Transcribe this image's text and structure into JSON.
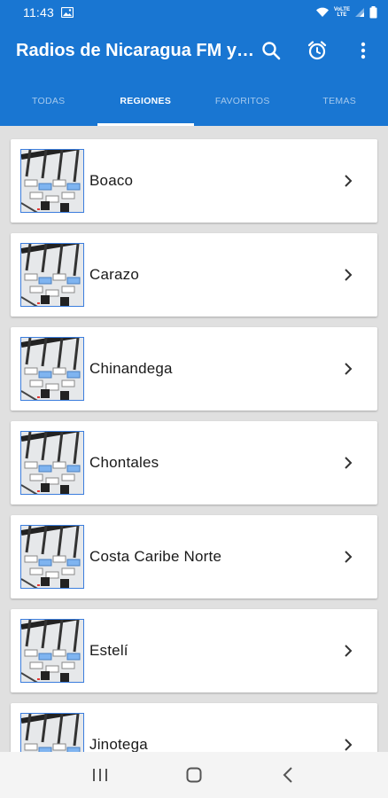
{
  "status": {
    "time": "11:43",
    "icons": [
      "gallery-icon",
      "wifi-icon",
      "volte-lte-icon",
      "signal-icon",
      "battery-icon"
    ],
    "network_label_top": "VoLTE",
    "network_label_bottom": "LTE"
  },
  "app_bar": {
    "title": "Radios de Nicaragua FM y AM",
    "actions": [
      "search-icon",
      "alarm-icon",
      "more-vert-icon"
    ]
  },
  "tabs": [
    {
      "label": "TODAS",
      "active": false
    },
    {
      "label": "REGIONES",
      "active": true
    },
    {
      "label": "FAVORITOS",
      "active": false
    },
    {
      "label": "TEMAS",
      "active": false
    }
  ],
  "regions": [
    {
      "label": "Boaco"
    },
    {
      "label": "Carazo"
    },
    {
      "label": "Chinandega"
    },
    {
      "label": "Chontales"
    },
    {
      "label": "Costa Caribe Norte"
    },
    {
      "label": "Estelí"
    },
    {
      "label": "Jinotega"
    }
  ],
  "nav": [
    "recents-icon",
    "home-icon",
    "back-icon"
  ],
  "colors": {
    "primary": "#1976d2",
    "card": "#ffffff",
    "background": "#e0e0e0",
    "thumb_border": "#3b7ddd"
  }
}
